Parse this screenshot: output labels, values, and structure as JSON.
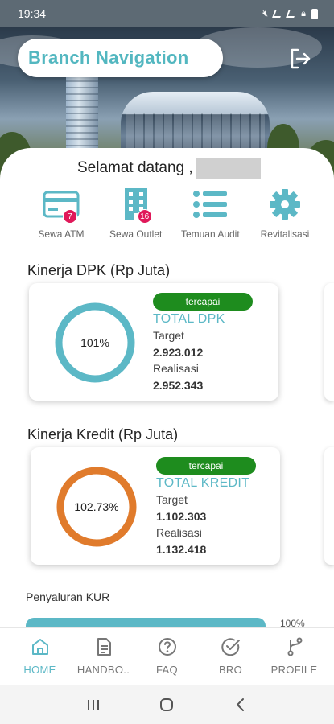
{
  "status_bar": {
    "time": "19:34"
  },
  "header": {
    "title": "Branch Navigation"
  },
  "welcome": {
    "text": "Selamat datang ,"
  },
  "menu": [
    {
      "label": "Sewa ATM",
      "icon": "atm-card-icon",
      "badge": "7"
    },
    {
      "label": "Sewa Outlet",
      "icon": "building-icon",
      "badge": "16"
    },
    {
      "label": "Temuan Audit",
      "icon": "list-icon",
      "badge": ""
    },
    {
      "label": "Revitalisasi",
      "icon": "gear-icon",
      "badge": ""
    }
  ],
  "dpk": {
    "section_title": "Kinerja DPK (Rp Juta)",
    "percent": "101%",
    "percent_value": 101,
    "status": "tercapai",
    "name": "TOTAL DPK",
    "target_label": "Target",
    "target_value": "2.923.012",
    "realisasi_label": "Realisasi",
    "realisasi_value": "2.952.343",
    "ring_color": "#5cb8c6"
  },
  "kredit": {
    "section_title": "Kinerja Kredit (Rp Juta)",
    "percent": "102.73%",
    "percent_value": 102.73,
    "status": "tercapai",
    "name": "TOTAL KREDIT",
    "target_label": "Target",
    "target_value": "1.102.303",
    "realisasi_label": "Realisasi",
    "realisasi_value": "1.132.418",
    "ring_color": "#e07b2c"
  },
  "kur": {
    "label": "Penyaluran KUR",
    "percent": "100%"
  },
  "nav": [
    {
      "label": "HOME",
      "icon": "home-icon",
      "active": true
    },
    {
      "label": "HANDBO..",
      "icon": "document-icon",
      "active": false
    },
    {
      "label": "FAQ",
      "icon": "question-icon",
      "active": false
    },
    {
      "label": "BRO",
      "icon": "check-circle-icon",
      "active": false
    },
    {
      "label": "PROFILE",
      "icon": "branch-icon",
      "active": false
    }
  ],
  "colors": {
    "accent": "#5cb8c6",
    "badge": "#e0195a",
    "success": "#1e8c1e",
    "orange": "#e07b2c"
  }
}
